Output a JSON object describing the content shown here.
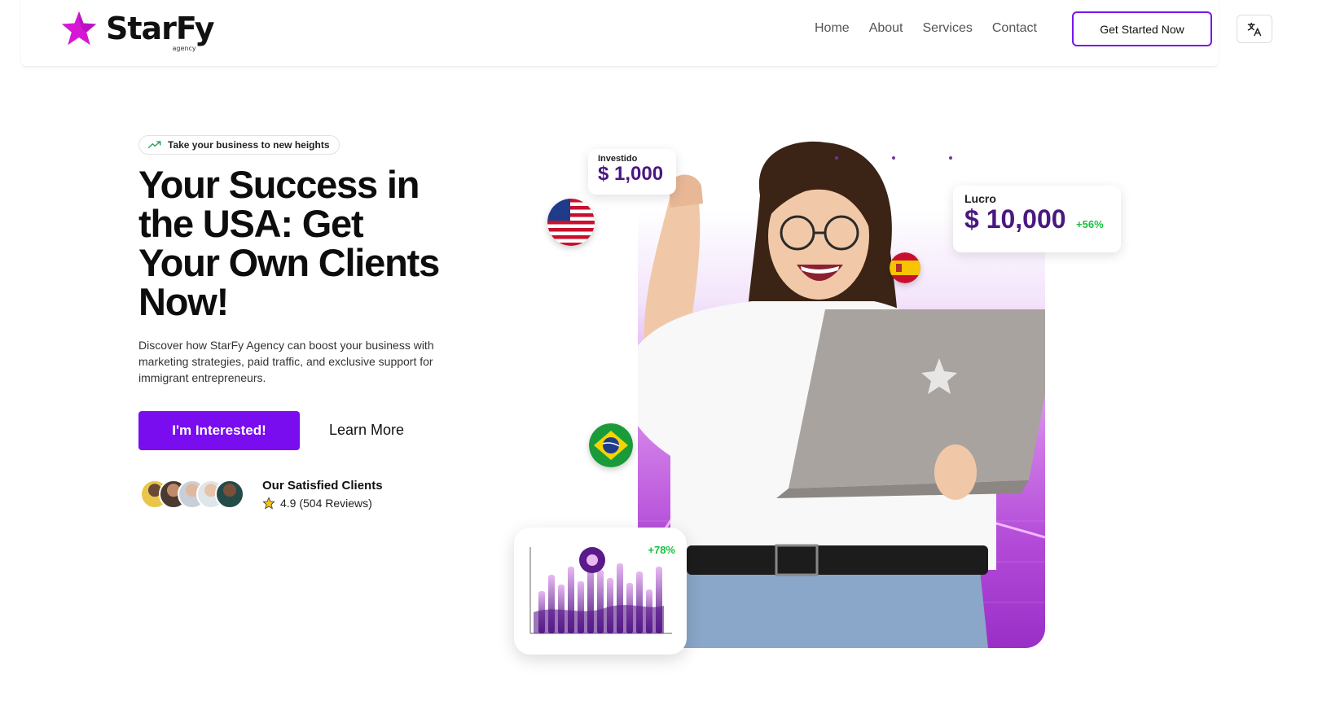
{
  "brand": {
    "name": "StarFy",
    "subtitle": "agency",
    "accent": "#7a0cf0",
    "logo_star_color": "#d617d6"
  },
  "nav": {
    "items": [
      {
        "label": "Home"
      },
      {
        "label": "About"
      },
      {
        "label": "Services"
      },
      {
        "label": "Contact"
      }
    ],
    "cta_label": "Get Started Now",
    "language_icon": "translate-icon"
  },
  "hero": {
    "badge": "Take your business to new heights",
    "badge_icon": "trending-up-icon",
    "title": "Your Success in the USA: Get Your Own Clients Now!",
    "description": "Discover how StarFy Agency can boost your business with marketing strategies, paid traffic, and exclusive support for immigrant entrepreneurs.",
    "primary_button": "I'm Interested!",
    "secondary_button": "Learn More",
    "clients_title": "Our Satisfied Clients",
    "rating_text": "4.9 (504 Reviews)",
    "rating_icon": "star-icon"
  },
  "visual": {
    "invest_label": "Investido",
    "invest_value": "$ 1,000",
    "profit_label": "Lucro",
    "profit_value": "$ 10,000",
    "profit_change": "+56%",
    "chart_change": "+78%",
    "flags": [
      "usa-flag",
      "spain-flag",
      "brazil-flag"
    ],
    "positive_color": "#18c040",
    "money_color": "#4a1880"
  }
}
